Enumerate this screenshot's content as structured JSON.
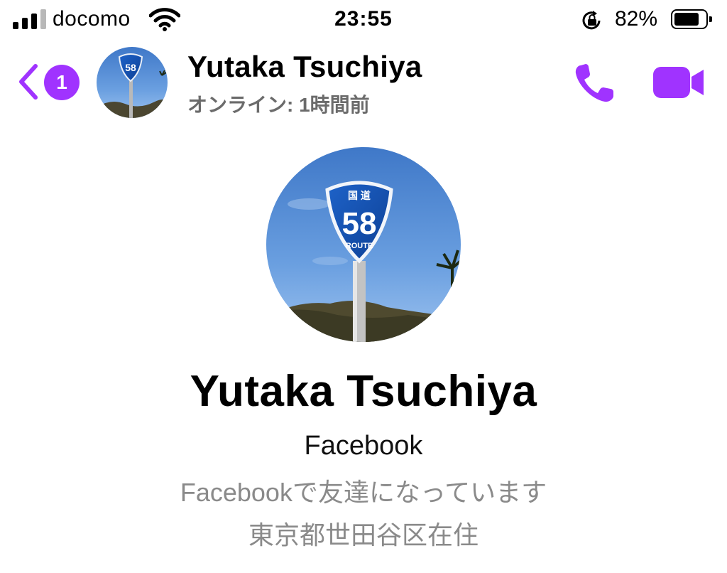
{
  "status_bar": {
    "carrier": "docomo",
    "time": "23:55",
    "battery_percent": "82%",
    "battery_level": 0.82,
    "signal_bars_filled": 3,
    "signal_bars_total": 4
  },
  "header": {
    "back_badge_count": "1",
    "contact_name": "Yutaka Tsuchiya",
    "online_status": "オンライン: 1時間前"
  },
  "profile": {
    "name": "Yutaka Tsuchiya",
    "source": "Facebook",
    "friend_status": "Facebookで友達になっています",
    "location": "東京都世田谷区在住"
  },
  "avatar": {
    "sign_number": "58",
    "sign_top_text": "国 道",
    "sign_bottom_text": "ROUTE"
  },
  "colors": {
    "accent": "#a033ff",
    "secondary_text": "#8a8a8a",
    "header_status_text": "#6b6b6b"
  },
  "icons": {
    "back": "chevron-left-icon",
    "call": "phone-icon",
    "video": "video-camera-icon",
    "wifi": "wifi-icon",
    "orientation_lock": "orientation-lock-icon",
    "battery": "battery-icon"
  }
}
